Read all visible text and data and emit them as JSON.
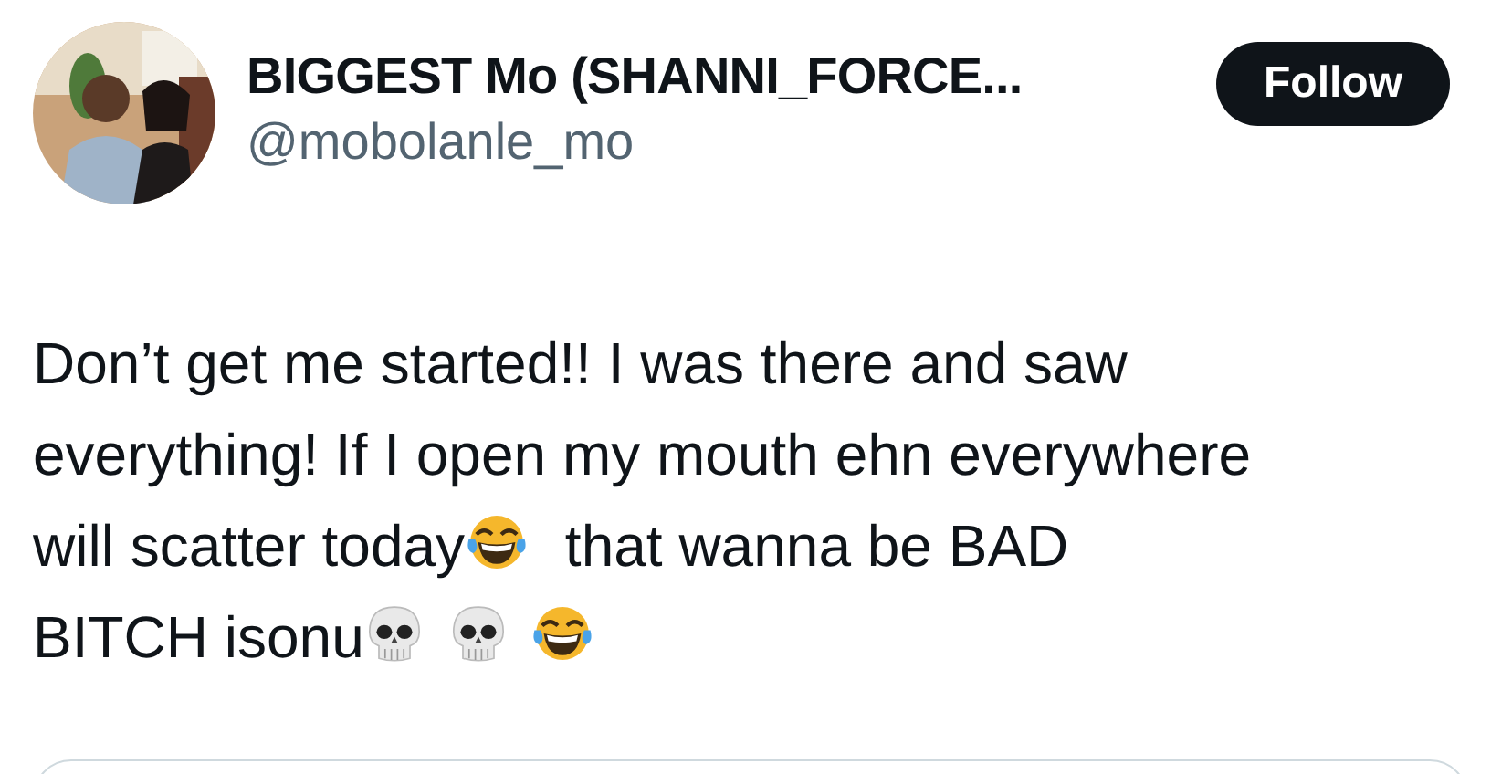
{
  "author": {
    "name": "BIGGEST Mo (SHANNI_FORCE...",
    "handle": "@mobolanle_mo"
  },
  "follow_button": {
    "label": "Follow"
  },
  "body": [
    {
      "kind": "text",
      "text": "Don’t get me started!! I was there and saw"
    },
    {
      "kind": "break"
    },
    {
      "kind": "text",
      "text": "everything! If I open my mouth ehn everywhere"
    },
    {
      "kind": "break"
    },
    {
      "kind": "text",
      "text": "will scatter today"
    },
    {
      "kind": "laugh"
    },
    {
      "kind": "text",
      "text": " that wanna be BAD"
    },
    {
      "kind": "break"
    },
    {
      "kind": "text",
      "text": "BITCH isonu"
    },
    {
      "kind": "skull"
    },
    {
      "kind": "skull"
    },
    {
      "kind": "laugh"
    }
  ]
}
